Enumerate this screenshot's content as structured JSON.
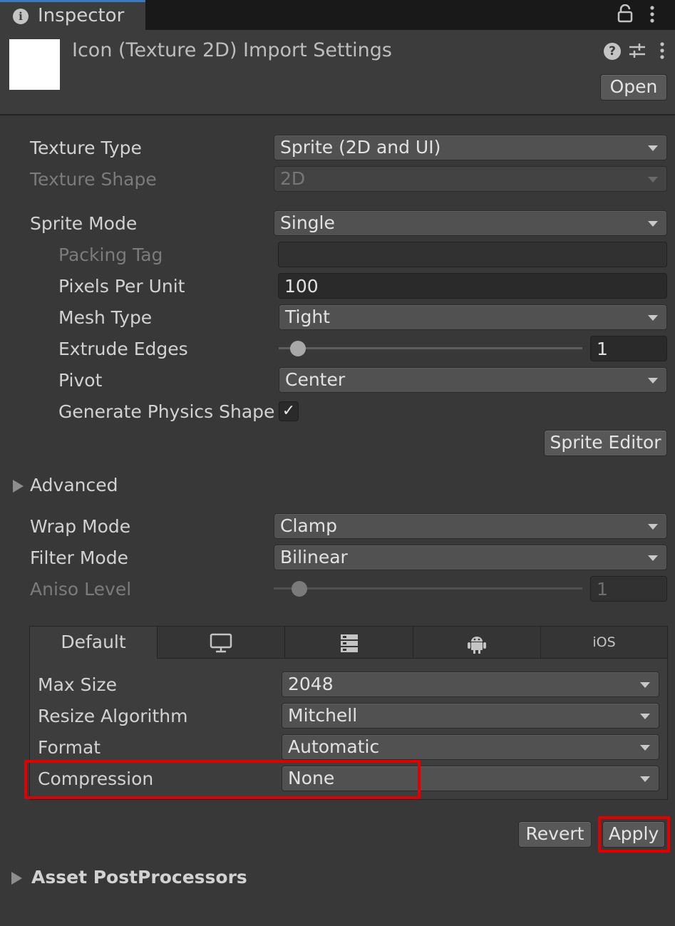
{
  "tab": {
    "title": "Inspector",
    "info_icon": "i"
  },
  "header": {
    "title": "Icon (Texture 2D) Import Settings",
    "help_icon": "?",
    "open_button": "Open"
  },
  "fields": {
    "texture_type": {
      "label": "Texture Type",
      "value": "Sprite (2D and UI)"
    },
    "texture_shape": {
      "label": "Texture Shape",
      "value": "2D"
    },
    "sprite_mode": {
      "label": "Sprite Mode",
      "value": "Single"
    },
    "packing_tag": {
      "label": "Packing Tag",
      "value": ""
    },
    "pixels_per_unit": {
      "label": "Pixels Per Unit",
      "value": "100"
    },
    "mesh_type": {
      "label": "Mesh Type",
      "value": "Tight"
    },
    "extrude_edges": {
      "label": "Extrude Edges",
      "value": "1",
      "fraction": 0.04
    },
    "pivot": {
      "label": "Pivot",
      "value": "Center"
    },
    "generate_physics_shape": {
      "label": "Generate Physics Shape",
      "checked": true,
      "check_glyph": "✓"
    },
    "sprite_editor_button": "Sprite Editor",
    "advanced": "Advanced",
    "wrap_mode": {
      "label": "Wrap Mode",
      "value": "Clamp"
    },
    "filter_mode": {
      "label": "Filter Mode",
      "value": "Bilinear"
    },
    "aniso_level": {
      "label": "Aniso Level",
      "value": "1",
      "fraction": 0.06
    }
  },
  "platform": {
    "tabs": [
      {
        "label": "Default",
        "icon": ""
      },
      {
        "label": "",
        "icon": "monitor-icon"
      },
      {
        "label": "",
        "icon": "server-icon"
      },
      {
        "label": "",
        "icon": "android-icon"
      },
      {
        "label": "iOS",
        "icon": ""
      }
    ],
    "max_size": {
      "label": "Max Size",
      "value": "2048"
    },
    "resize_algorithm": {
      "label": "Resize Algorithm",
      "value": "Mitchell"
    },
    "format": {
      "label": "Format",
      "value": "Automatic"
    },
    "compression": {
      "label": "Compression",
      "value": "None"
    }
  },
  "buttons": {
    "revert": "Revert",
    "apply": "Apply"
  },
  "asset_postprocessors": "Asset PostProcessors",
  "colors": {
    "highlight": "#e00000",
    "background": "#383838",
    "accent": "#3a79bb"
  }
}
